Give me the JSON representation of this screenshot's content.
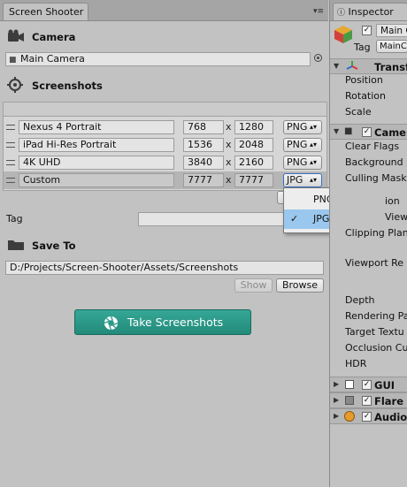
{
  "left_window": {
    "tab_title": "Screen Shooter",
    "camera_section": {
      "header": "Camera",
      "value": "Main Camera"
    },
    "screenshots_section": {
      "header": "Screenshots",
      "rows": [
        {
          "name": "Nexus 4 Portrait",
          "width": "768",
          "height": "1280",
          "format": "PNG"
        },
        {
          "name": "iPad Hi-Res Portrait",
          "width": "1536",
          "height": "2048",
          "format": "PNG"
        },
        {
          "name": "4K UHD",
          "width": "3840",
          "height": "2160",
          "format": "PNG"
        },
        {
          "name": "Custom",
          "width": "7777",
          "height": "7777",
          "format": "JPG"
        }
      ],
      "times": "x"
    },
    "tag_label": "Tag",
    "save_to": {
      "header": "Save To",
      "path": "D:/Projects/Screen-Shooter/Assets/Screenshots",
      "show_label": "Show",
      "browse_label": "Browse"
    },
    "take_button_label": "Take Screenshots",
    "format_dropdown": {
      "options": [
        "PNG",
        "JPG"
      ],
      "selected": "JPG",
      "check": "✓"
    }
  },
  "inspector": {
    "tab_title": "Inspector",
    "object_name": "Main C",
    "tag_label": "Tag",
    "tag_value": "MainC",
    "transform": {
      "title": "Transf",
      "fields": [
        "Position",
        "Rotation",
        "Scale"
      ]
    },
    "camera": {
      "title": "Camer",
      "fields": [
        "Clear Flags",
        "Background",
        "Culling Mask"
      ],
      "partial_fields": [
        "ion",
        "View",
        "Clipping Plan"
      ],
      "lower_fields": [
        "Viewport Re",
        "Depth",
        "Rendering Pa",
        "Target Textu",
        "Occlusion Cu",
        "HDR"
      ]
    },
    "components": [
      {
        "title": "GUI La"
      },
      {
        "title": "Flare"
      },
      {
        "title": "Audio"
      }
    ]
  }
}
